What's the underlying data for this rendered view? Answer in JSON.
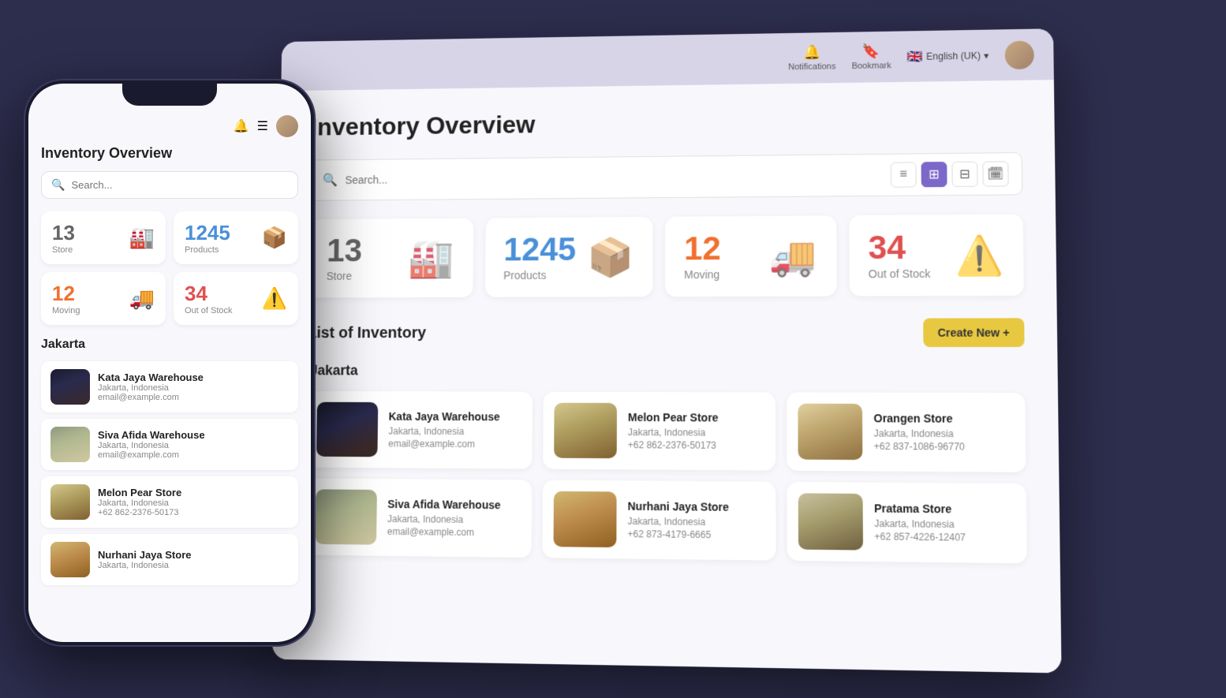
{
  "app": {
    "title": "Inventory Overview",
    "language": "English (UK)",
    "search_placeholder": "Search..."
  },
  "topbar": {
    "notifications_label": "Notifications",
    "bookmark_label": "Bookmark",
    "language_label": "English (UK)"
  },
  "stats": [
    {
      "number": "13",
      "label": "Store",
      "color": "gray",
      "icon": "🏭"
    },
    {
      "number": "1245",
      "label": "Products",
      "color": "blue",
      "icon": "📦"
    },
    {
      "number": "12",
      "label": "Moving",
      "color": "orange",
      "icon": "🚚"
    },
    {
      "number": "34",
      "label": "Out of Stock",
      "color": "red",
      "icon": "⚠️"
    }
  ],
  "inventory_section": {
    "title": "List of Inventory",
    "create_button": "Create New +"
  },
  "city_section": {
    "name": "Jakarta"
  },
  "inventory_items": [
    {
      "name": "Kata Jaya Warehouse",
      "location": "Jakarta, Indonesia",
      "contact": "email@example.com",
      "img_type": "warehouse-dark"
    },
    {
      "name": "Melon Pear Store",
      "location": "Jakarta, Indonesia",
      "contact": "+62 862-2376-50173",
      "img_type": "store-shelf"
    },
    {
      "name": "Orangen Store",
      "location": "Jakarta, Indonesia",
      "contact": "+62 837-1086-96770",
      "img_type": "store-market"
    },
    {
      "name": "Siva Afida Warehouse",
      "location": "Jakarta, Indonesia",
      "contact": "email@example.com",
      "img_type": "warehouse-light"
    },
    {
      "name": "Nurhani Jaya Store",
      "location": "Jakarta, Indonesia",
      "contact": "+62 873-4179-6665",
      "img_type": "store-shelf2"
    },
    {
      "name": "Pratama Store",
      "location": "Jakarta, Indonesia",
      "contact": "+62 857-4226-12407",
      "img_type": "store-market2"
    }
  ],
  "mobile": {
    "title": "Inventory Overview",
    "search_placeholder": "Search...",
    "city": "Jakarta",
    "list_items": [
      {
        "name": "Kata Jaya Warehouse",
        "location": "Jakarta, Indonesia",
        "contact": "email@example.com",
        "img_type": "warehouse-dark"
      },
      {
        "name": "Siva Afida Warehouse",
        "location": "Jakarta, Indonesia",
        "contact": "email@example.com",
        "img_type": "warehouse-light"
      },
      {
        "name": "Melon Pear Store",
        "location": "Jakarta, Indonesia",
        "contact": "+62 862-2376-50173",
        "img_type": "store-shelf"
      },
      {
        "name": "Nurhani Jaya Store",
        "location": "Jakarta, Indonesia",
        "contact": "",
        "img_type": "store-market"
      }
    ]
  },
  "view_buttons": [
    "≡",
    "⊞",
    "⊟",
    "🗓"
  ],
  "colors": {
    "accent_purple": "#7b68c8",
    "accent_yellow": "#e8c840",
    "stat_blue": "#4a90d9",
    "stat_orange": "#f07030",
    "stat_red": "#e05050",
    "stat_gray": "#666666",
    "topbar_bg": "#d8d4e8",
    "page_bg": "#f8f8fc"
  }
}
